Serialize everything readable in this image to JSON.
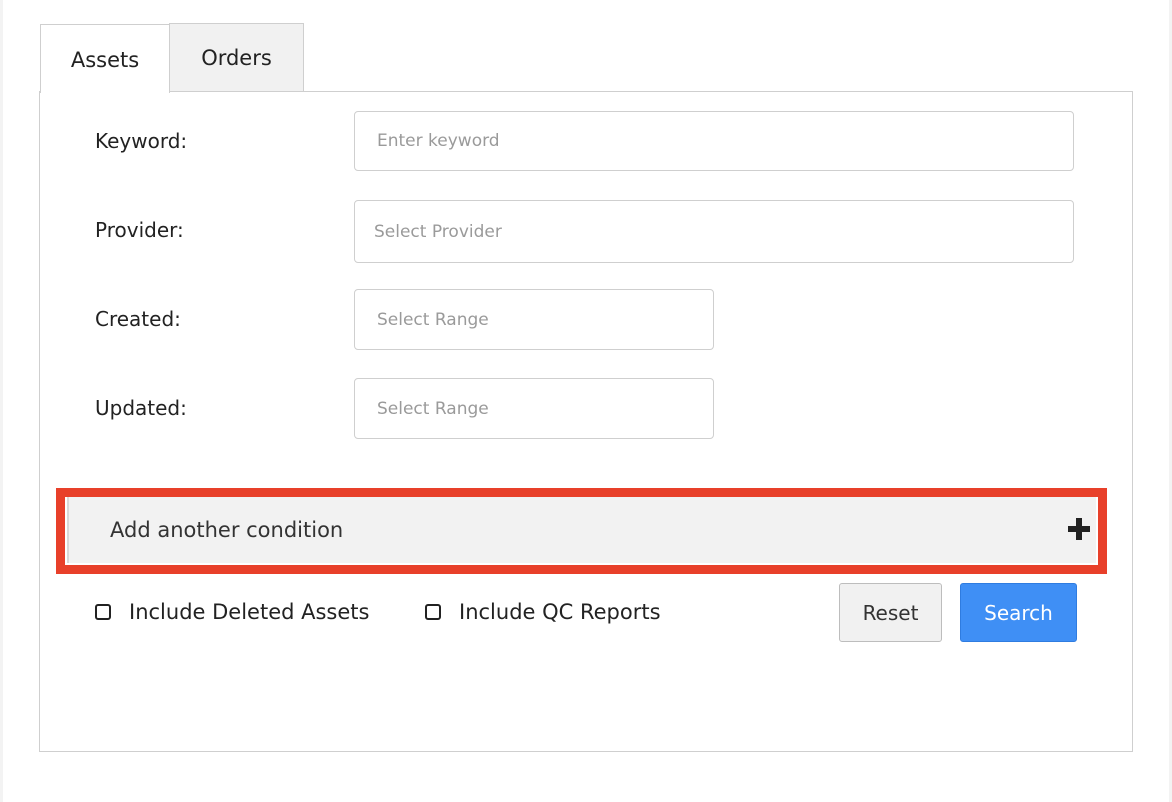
{
  "tabs": [
    {
      "label": "Assets",
      "active": true
    },
    {
      "label": "Orders",
      "active": false
    }
  ],
  "form": {
    "keyword": {
      "label": "Keyword:",
      "placeholder": "Enter keyword",
      "value": ""
    },
    "provider": {
      "label": "Provider:",
      "placeholder": "Select Provider",
      "value": ""
    },
    "created": {
      "label": "Created:",
      "placeholder": "Select Range",
      "value": ""
    },
    "updated": {
      "label": "Updated:",
      "placeholder": "Select Range",
      "value": ""
    }
  },
  "condition": {
    "label": "Add another condition",
    "icon": "plus-icon",
    "highlight_color": "#e8402a"
  },
  "options": {
    "include_deleted": {
      "label": "Include Deleted Assets",
      "checked": false
    },
    "include_qc": {
      "label": "Include QC Reports",
      "checked": false
    }
  },
  "actions": {
    "reset_label": "Reset",
    "search_label": "Search"
  },
  "colors": {
    "primary": "#3f8ff5",
    "highlight": "#e8402a"
  }
}
